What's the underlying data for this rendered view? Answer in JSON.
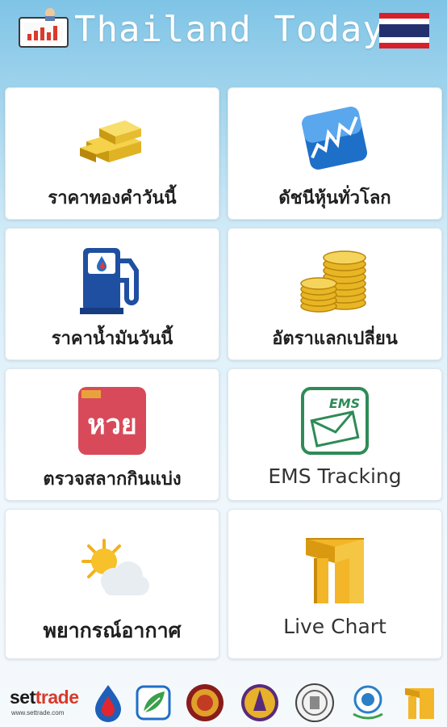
{
  "header": {
    "title": "Thailand Today",
    "app_icon": "chart-monitor-icon",
    "flag_icon": "thailand-flag-icon"
  },
  "tiles": [
    {
      "label": "ราคาทองคำวันนี้",
      "icon": "gold-bars-icon"
    },
    {
      "label": "ดัชนีหุ้นทั่วโลก",
      "icon": "stock-chart-icon"
    },
    {
      "label": "ราคาน้ำมันวันนี้",
      "icon": "fuel-pump-icon"
    },
    {
      "label": "อัตราแลกเปลี่ยน",
      "icon": "coins-icon"
    },
    {
      "label": "ตรวจสลากกินแบ่ง",
      "icon": "lottery-icon",
      "badge": "หวย"
    },
    {
      "label": "EMS Tracking",
      "icon": "ems-mail-icon",
      "badge": "EMS"
    },
    {
      "label": "พยากรณ์อากาศ",
      "icon": "weather-icon"
    },
    {
      "label": "Live Chart",
      "icon": "live-chart-icon"
    }
  ],
  "footer": {
    "settrade_prefix": "set",
    "settrade_suffix": "trade",
    "settrade_url": "www.settrade.com",
    "logos": [
      "ptt-logo",
      "leaf-logo",
      "royal-emblem-logo",
      "temple-logo",
      "seal-logo",
      "ministry-logo",
      "live-chart-logo"
    ]
  },
  "colors": {
    "header_top": "#7fc4e6",
    "tile_bg": "#ffffff",
    "accent_blue": "#1a5fb4",
    "gold": "#e6b422",
    "lottery_red": "#d84a5a",
    "ems_green": "#2e8b57"
  }
}
